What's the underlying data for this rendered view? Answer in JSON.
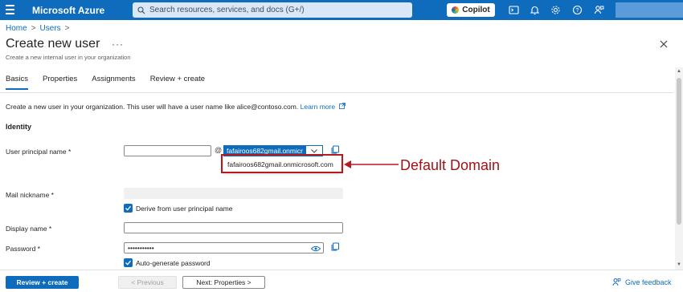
{
  "topbar": {
    "brand": "Microsoft Azure",
    "search_placeholder": "Search resources, services, and docs (G+/)",
    "copilot_label": "Copilot",
    "icons": [
      "cloud-shell-icon",
      "bell-icon",
      "gear-icon",
      "help-icon",
      "feedback-person-icon"
    ]
  },
  "breadcrumb": {
    "home": "Home",
    "users": "Users"
  },
  "page": {
    "title": "Create new user",
    "more": "···",
    "subtitle": "Create a new internal user in your organization"
  },
  "tabs": [
    {
      "label": "Basics",
      "active": true
    },
    {
      "label": "Properties",
      "active": false
    },
    {
      "label": "Assignments",
      "active": false
    },
    {
      "label": "Review + create",
      "active": false
    }
  ],
  "intro": {
    "text": "Create a new user in your organization. This user will have a user name like alice@contoso.com.",
    "link": "Learn more"
  },
  "form": {
    "section": "Identity",
    "upn_label": "User principal name *",
    "upn_value": "",
    "at": "@",
    "domain_selected": "fafairoos682gmail.onmicr",
    "domain_option": "fafairoos682gmail.onmicrosoft.com",
    "mail_label": "Mail nickname *",
    "mail_value": "",
    "derive_label": "Derive from user principal name",
    "derive_checked": true,
    "display_label": "Display name *",
    "display_value": "",
    "password_label": "Password *",
    "password_value": "•••••••••••",
    "autogen_label": "Auto-generate password",
    "autogen_checked": true
  },
  "annotation": {
    "text": "Default Domain",
    "color": "#a11217"
  },
  "footer": {
    "review_label": "Review + create",
    "prev_label": "< Previous",
    "next_label": "Next: Properties  >",
    "feedback_label": "Give feedback"
  },
  "colors": {
    "accent": "#0f6cbd",
    "annotation": "#b51a1f"
  }
}
